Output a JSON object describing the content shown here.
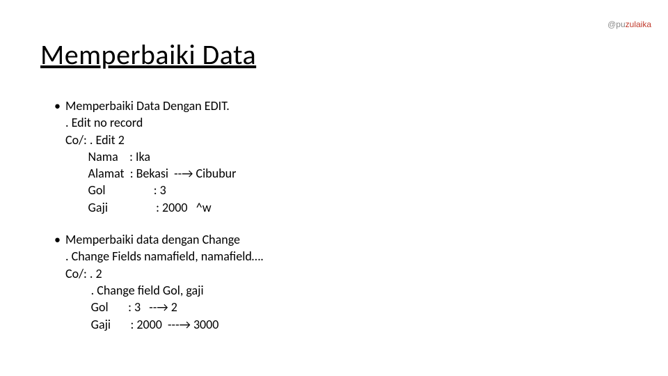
{
  "watermark": {
    "grey": "@pu",
    "red": "zulaika"
  },
  "title": "Memperbaiki Data",
  "bullets": [
    {
      "lead": "Memperbaiki Data Dengan EDIT.",
      "lines": [
        ". Edit no record",
        "Co/: . Edit 2",
        "        Nama    : Ika",
        "        Alamat  : Bekasi  --→ Cibubur",
        "        Gol                 : 3",
        "        Gaji                 : 2000   ^w"
      ]
    },
    {
      "lead": "Memperbaiki data dengan Change",
      "lines": [
        ". Change Fields namafield, namafield….",
        "Co/: . 2",
        "         . Change field Gol, gaji",
        "         Gol       : 3   --→ 2",
        "         Gaji       : 2000  ---→ 3000"
      ]
    }
  ]
}
